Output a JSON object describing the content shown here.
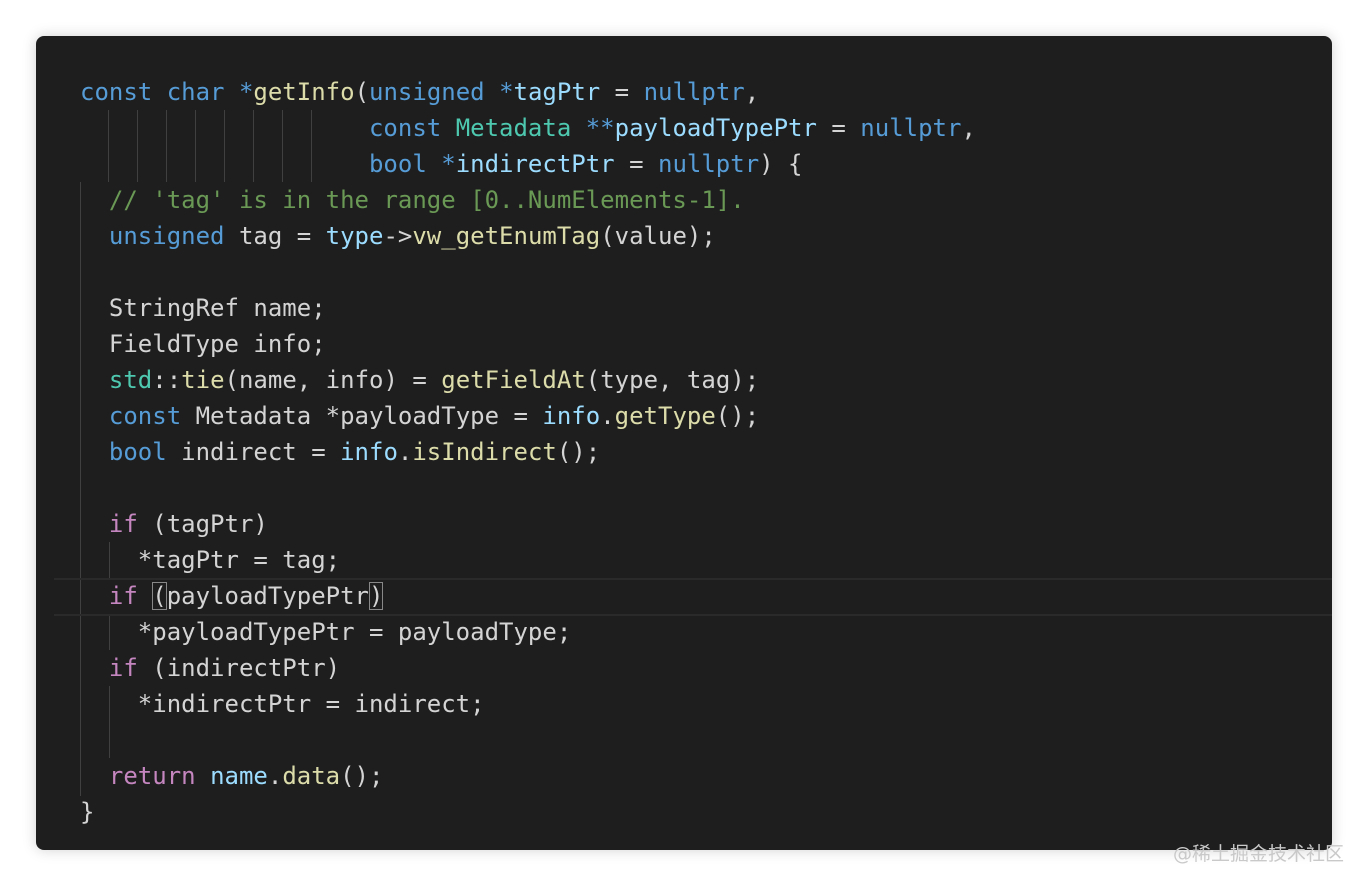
{
  "editor": {
    "theme_colors": {
      "background": "#1e1e1e",
      "keyword": "#569cd6",
      "function": "#dcdcaa",
      "type": "#4ec9b0",
      "variable": "#9cdcfe",
      "comment": "#6a9955",
      "control": "#c586c0",
      "plain": "#d4d4d4"
    },
    "lines": [
      [
        [
          "kw",
          "const"
        ],
        [
          "pl",
          " "
        ],
        [
          "kw",
          "char"
        ],
        [
          "pl",
          " "
        ],
        [
          "kw",
          "*"
        ],
        [
          "fn",
          "getInfo"
        ],
        [
          "pl",
          "("
        ],
        [
          "kw",
          "unsigned"
        ],
        [
          "pl",
          " "
        ],
        [
          "kw",
          "*"
        ],
        [
          "vr",
          "tagPtr"
        ],
        [
          "pl",
          " = "
        ],
        [
          "kw",
          "nullptr"
        ],
        [
          "pl",
          ","
        ]
      ],
      [
        [
          "pl",
          "                    "
        ],
        [
          "kw",
          "const"
        ],
        [
          "pl",
          " "
        ],
        [
          "ty",
          "Metadata"
        ],
        [
          "pl",
          " "
        ],
        [
          "kw",
          "**"
        ],
        [
          "vr",
          "payloadTypePtr"
        ],
        [
          "pl",
          " = "
        ],
        [
          "kw",
          "nullptr"
        ],
        [
          "pl",
          ","
        ]
      ],
      [
        [
          "pl",
          "                    "
        ],
        [
          "kw",
          "bool"
        ],
        [
          "pl",
          " "
        ],
        [
          "kw",
          "*"
        ],
        [
          "vr",
          "indirectPtr"
        ],
        [
          "pl",
          " = "
        ],
        [
          "kw",
          "nullptr"
        ],
        [
          "pl",
          ") {"
        ]
      ],
      [
        [
          "pl",
          "  "
        ],
        [
          "cm",
          "// 'tag' is in the range [0..NumElements-1]."
        ]
      ],
      [
        [
          "pl",
          "  "
        ],
        [
          "kw",
          "unsigned"
        ],
        [
          "pl",
          " tag = "
        ],
        [
          "vr",
          "type"
        ],
        [
          "pl",
          "->"
        ],
        [
          "fn",
          "vw_getEnumTag"
        ],
        [
          "pl",
          "(value);"
        ]
      ],
      [],
      [
        [
          "pl",
          "  StringRef name;"
        ]
      ],
      [
        [
          "pl",
          "  FieldType info;"
        ]
      ],
      [
        [
          "pl",
          "  "
        ],
        [
          "ty",
          "std"
        ],
        [
          "pl",
          "::"
        ],
        [
          "fn",
          "tie"
        ],
        [
          "pl",
          "(name, info) = "
        ],
        [
          "fn",
          "getFieldAt"
        ],
        [
          "pl",
          "(type, tag);"
        ]
      ],
      [
        [
          "pl",
          "  "
        ],
        [
          "kw",
          "const"
        ],
        [
          "pl",
          " Metadata *payloadType = "
        ],
        [
          "vr",
          "info"
        ],
        [
          "pl",
          "."
        ],
        [
          "fn",
          "getType"
        ],
        [
          "pl",
          "();"
        ]
      ],
      [
        [
          "pl",
          "  "
        ],
        [
          "kw",
          "bool"
        ],
        [
          "pl",
          " indirect = "
        ],
        [
          "vr",
          "info"
        ],
        [
          "pl",
          "."
        ],
        [
          "fn",
          "isIndirect"
        ],
        [
          "pl",
          "();"
        ]
      ],
      [],
      [
        [
          "pl",
          "  "
        ],
        [
          "ct",
          "if"
        ],
        [
          "pl",
          " (tagPtr)"
        ]
      ],
      [
        [
          "pl",
          "    *tagPtr = tag;"
        ]
      ],
      [
        [
          "pl",
          "  "
        ],
        [
          "ct",
          "if"
        ],
        [
          "pl",
          " "
        ],
        [
          "box",
          "("
        ],
        [
          "pl",
          "payloadTypePtr"
        ],
        [
          "box",
          ")"
        ]
      ],
      [
        [
          "pl",
          "    *payloadTypePtr = payloadType;"
        ]
      ],
      [
        [
          "pl",
          "  "
        ],
        [
          "ct",
          "if"
        ],
        [
          "pl",
          " (indirectPtr)"
        ]
      ],
      [
        [
          "pl",
          "    *indirectPtr = indirect;"
        ]
      ],
      [],
      [
        [
          "pl",
          "  "
        ],
        [
          "ct",
          "return"
        ],
        [
          "pl",
          " "
        ],
        [
          "vr",
          "name"
        ],
        [
          "pl",
          "."
        ],
        [
          "fn",
          "data"
        ],
        [
          "pl",
          "();"
        ]
      ],
      [
        [
          "pl",
          "}"
        ]
      ]
    ],
    "current_line_index": 14
  },
  "watermark": "@稀土掘金技术社区"
}
